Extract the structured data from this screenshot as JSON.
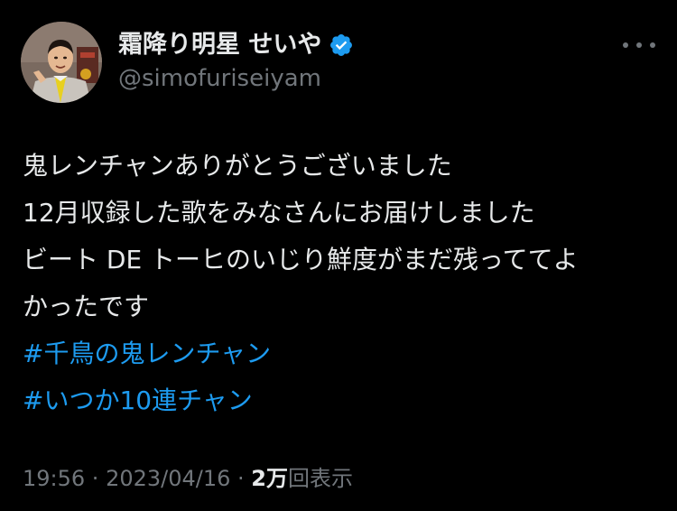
{
  "author": {
    "display_name": "霜降り明星 せいや",
    "handle": "@simofuriseiyam",
    "verified": true,
    "avatar_icon": "profile-photo"
  },
  "post": {
    "lines": [
      "鬼レンチャンありがとうございました",
      "12月収録した歌をみなさんにお届けしました",
      "ビート DE トーヒのいじり鮮度がまだ残っててよ",
      "かったです"
    ],
    "hashtags": [
      "#千鳥の鬼レンチャン",
      "#いつか10連チャン"
    ]
  },
  "meta": {
    "time": "19:56",
    "separator": " · ",
    "date": "2023/04/16",
    "views_count": "2万",
    "views_label": "回表示"
  },
  "menu": {
    "icon": "more-dots-icon"
  },
  "colors": {
    "background": "#000000",
    "text": "#e7e9ea",
    "secondary": "#71767b",
    "accent": "#1d9bf0"
  }
}
